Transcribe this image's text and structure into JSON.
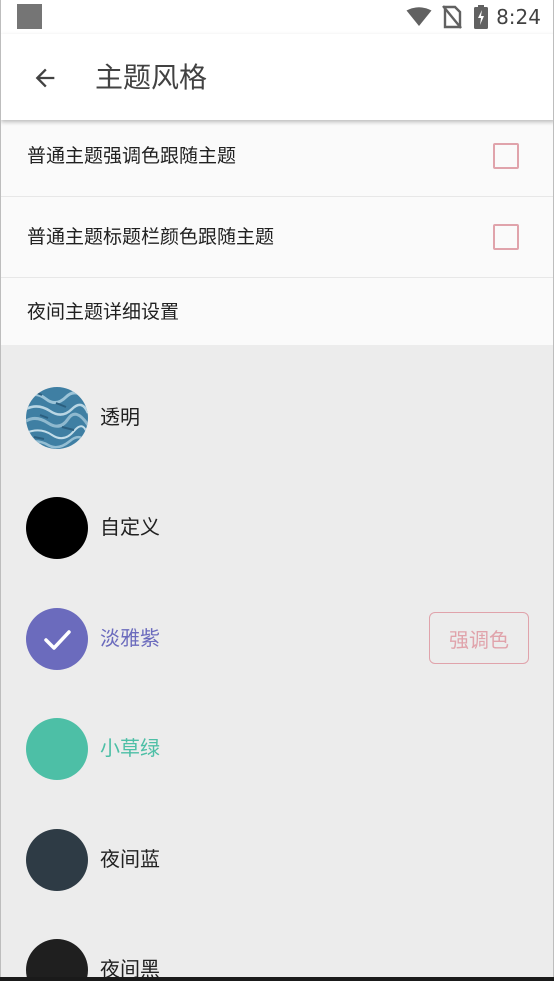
{
  "status_bar": {
    "time": "8:24",
    "icons": [
      "app-notification-icon",
      "wifi-icon",
      "no-sim-icon",
      "battery-charging-icon"
    ]
  },
  "app_bar": {
    "title": "主题风格",
    "back_icon": "arrow-back-icon"
  },
  "settings": {
    "items": [
      {
        "label": "普通主题强调色跟随主题",
        "checked": false
      },
      {
        "label": "普通主题标题栏颜色跟随主题",
        "checked": false
      },
      {
        "label": "夜间主题详细设置"
      }
    ],
    "checkbox_color": "#e0a3ab"
  },
  "themes": {
    "items": [
      {
        "name": "透明",
        "color": "#4a86a8",
        "swatch": "water-texture",
        "selected": false
      },
      {
        "name": "自定义",
        "color": "#000000",
        "selected": false
      },
      {
        "name": "淡雅紫",
        "color": "#6b6bbd",
        "selected": true,
        "name_color": "#6b6bbd"
      },
      {
        "name": "小草绿",
        "color": "#4dbfa6",
        "selected": false,
        "name_color": "#4dbfa6"
      },
      {
        "name": "夜间蓝",
        "color": "#2e3b45",
        "selected": false
      },
      {
        "name": "夜间黑",
        "color": "#1f1f1f",
        "selected": false
      }
    ],
    "accent_button_label": "强调色",
    "accent_button_color": "#e0a3ab"
  }
}
